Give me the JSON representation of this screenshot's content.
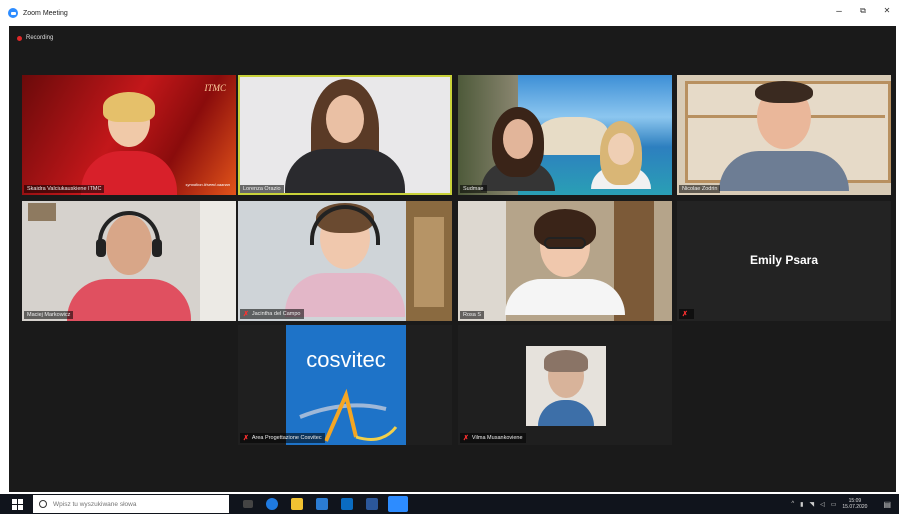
{
  "window": {
    "title": "Zoom Meeting",
    "minimize": "–",
    "maximize": "⧉",
    "close": "✕"
  },
  "recording": {
    "label": "Recording"
  },
  "participants": [
    {
      "name": "Skaidra Valciukauskiene ITMC",
      "muted": false
    },
    {
      "name": "Lorenza Orazio",
      "muted": false
    },
    {
      "name": "Sudmae",
      "muted": false
    },
    {
      "name": "Nicolae Zodrin",
      "muted": false
    },
    {
      "name": "Maciej Markowicz",
      "muted": false
    },
    {
      "name": "Jacintha del Campo",
      "muted": true
    },
    {
      "name": "Rosa S",
      "muted": false
    },
    {
      "name": "Emily Psara",
      "muted": true
    },
    {
      "name": "Area Progettazione Cosvitec",
      "muted": true
    },
    {
      "name": "Vilma Musankoviene",
      "muted": true
    }
  ],
  "tiles": {
    "t1_logo": "ITMC",
    "t1_caption": "synodkon.lt/seed.uaanan",
    "center_name": "Emily Psara",
    "cosvitec_logo": "cosvitec"
  },
  "taskbar": {
    "search_placeholder": "Wpisz tu wyszukiwane słowa",
    "clock_time": "15:09",
    "clock_date": "15.07.2020"
  },
  "colors": {
    "active_speaker": "#c9d23a",
    "mute": "#ff3030",
    "zoom_blue": "#2d8cff"
  }
}
